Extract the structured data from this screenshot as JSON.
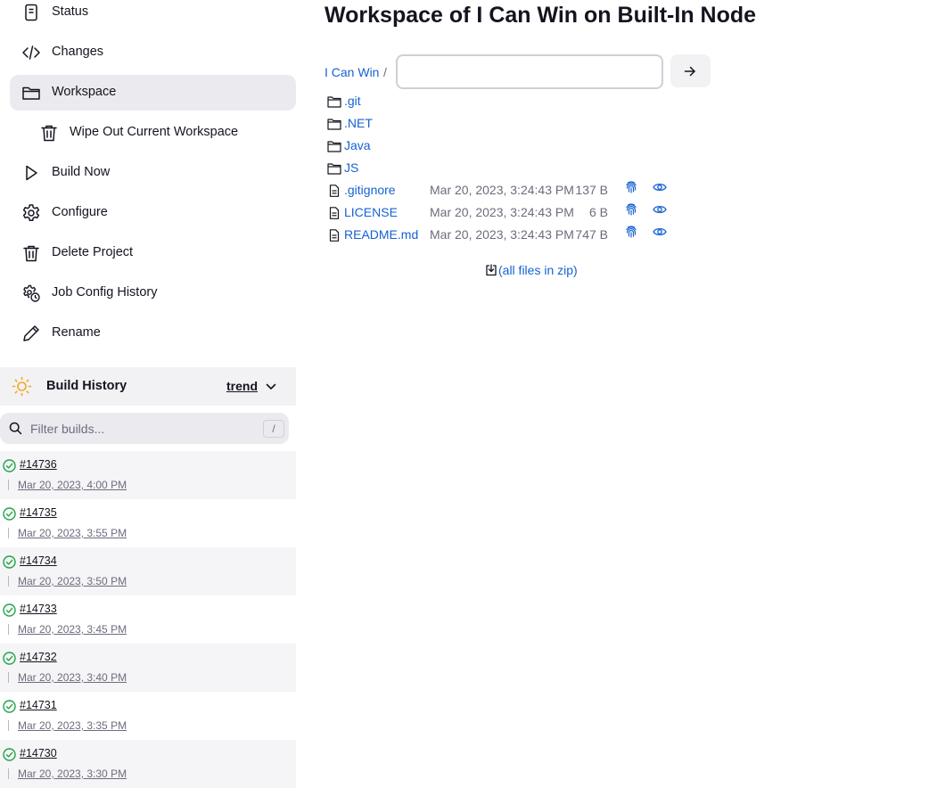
{
  "sidebar": {
    "tasks": [
      {
        "label": "Status",
        "icon": "status-icon"
      },
      {
        "label": "Changes",
        "icon": "code-icon"
      },
      {
        "label": "Workspace",
        "icon": "folder-icon"
      },
      {
        "label": "Wipe Out Current Workspace",
        "icon": "trash-icon"
      },
      {
        "label": "Build Now",
        "icon": "play-icon"
      },
      {
        "label": "Configure",
        "icon": "gear-icon"
      },
      {
        "label": "Delete Project",
        "icon": "trash-icon"
      },
      {
        "label": "Job Config History",
        "icon": "config-history-icon"
      },
      {
        "label": "Rename",
        "icon": "pencil-icon"
      }
    ],
    "active_task": "Workspace"
  },
  "build_history": {
    "title": "Build History",
    "trend_label": "trend",
    "filter_placeholder": "Filter builds...",
    "filter_shortcut": "/",
    "builds": [
      {
        "number": "#14736",
        "date": "Mar 20, 2023, 4:00 PM",
        "status": "success"
      },
      {
        "number": "#14735",
        "date": "Mar 20, 2023, 3:55 PM",
        "status": "success"
      },
      {
        "number": "#14734",
        "date": "Mar 20, 2023, 3:50 PM",
        "status": "success"
      },
      {
        "number": "#14733",
        "date": "Mar 20, 2023, 3:45 PM",
        "status": "success"
      },
      {
        "number": "#14732",
        "date": "Mar 20, 2023, 3:40 PM",
        "status": "success"
      },
      {
        "number": "#14731",
        "date": "Mar 20, 2023, 3:35 PM",
        "status": "success"
      },
      {
        "number": "#14730",
        "date": "Mar 20, 2023, 3:30 PM",
        "status": "success"
      }
    ]
  },
  "main": {
    "title": "Workspace of I Can Win on Built-In Node",
    "breadcrumb": {
      "root": "I Can Win",
      "separator": "/"
    },
    "path_input_value": "",
    "go_button_icon": "arrow-right-icon",
    "entries": [
      {
        "name": ".git",
        "type": "folder"
      },
      {
        "name": ".NET",
        "type": "folder"
      },
      {
        "name": "Java",
        "type": "folder"
      },
      {
        "name": "JS",
        "type": "folder"
      },
      {
        "name": ".gitignore",
        "type": "file",
        "date": "Mar 20, 2023, 3:24:43 PM",
        "size": "137 B"
      },
      {
        "name": "LICENSE",
        "type": "file",
        "date": "Mar 20, 2023, 3:24:43 PM",
        "size": "6 B"
      },
      {
        "name": "README.md",
        "type": "file",
        "date": "Mar 20, 2023, 3:24:43 PM",
        "size": "747 B"
      }
    ],
    "zip_label": "(all files in zip)"
  },
  "colors": {
    "link": "#1662d2",
    "text": "#14141f",
    "muted": "#6d6b7d",
    "success": "#1ea446",
    "sun": "#f4a622",
    "active_bg": "#ebebef"
  }
}
